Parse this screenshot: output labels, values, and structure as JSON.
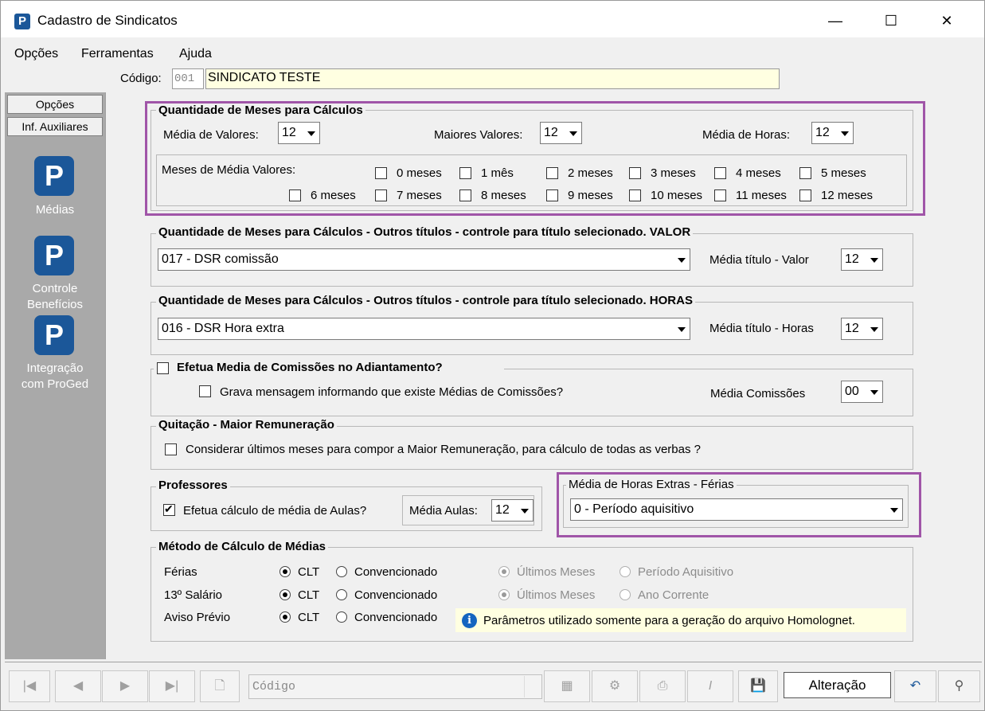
{
  "window": {
    "title": "Cadastro de Sindicatos",
    "minimize": "—",
    "maximize": "☐",
    "close": "✕"
  },
  "menu": {
    "items": [
      "Opções",
      "Ferramentas",
      "Ajuda"
    ]
  },
  "codigo": {
    "label": "Código:",
    "code": "001",
    "name": "SINDICATO TESTE"
  },
  "sidebar": {
    "tabs": [
      "Opções",
      "Inf. Auxiliares"
    ],
    "items": [
      {
        "label": "Médias",
        "icon": "p-logo-icon"
      },
      {
        "label": "Controle\nBenefícios",
        "label1": "Controle",
        "label2": "Benefícios",
        "icon": "p-logo-icon"
      },
      {
        "label1": "Integração",
        "label2": "com ProGed",
        "icon": "p-logo-icon"
      }
    ]
  },
  "qtd_meses": {
    "title": "Quantidade de Meses para Cálculos",
    "media_valores_label": "Média de Valores:",
    "media_valores": "12",
    "maiores_valores_label": "Maiores Valores:",
    "maiores_valores": "12",
    "media_horas_label": "Média de Horas:",
    "media_horas": "12",
    "meses_media_label": "Meses de Média Valores:",
    "meses": [
      "0 meses",
      "1 mês",
      "2 meses",
      "3 meses",
      "4 meses",
      "5 meses",
      "6 meses",
      "7 meses",
      "8 meses",
      "9 meses",
      "10 meses",
      "11 meses",
      "12 meses"
    ]
  },
  "outros_valor": {
    "title": "Quantidade de Meses para Cálculos - Outros títulos - controle para título selecionado. VALOR",
    "titulo": "017 - DSR comissão",
    "media_label": "Média título - Valor",
    "media": "12"
  },
  "outros_horas": {
    "title": "Quantidade de Meses para Cálculos - Outros títulos - controle para título selecionado. HORAS",
    "titulo": "016 - DSR Hora extra",
    "media_label": "Média título - Horas",
    "media": "12"
  },
  "comissoes": {
    "title": "Efetua Media de Comissões no Adiantamento?",
    "grava_label": "Grava mensagem informando que existe Médias de Comissões?",
    "media_label": "Média Comissões",
    "media": "00"
  },
  "quitacao": {
    "title": "Quitação - Maior Remuneração",
    "considerar_label": "Considerar últimos meses para compor a Maior Remuneração, para cálculo de todas as verbas ?"
  },
  "professores": {
    "title": "Professores",
    "efetua_label": "Efetua cálculo de média de Aulas?",
    "efetua_checked": true,
    "media_label": "Média Aulas:",
    "media": "12"
  },
  "horas_extras_ferias": {
    "title": "Média de Horas Extras - Férias",
    "value": "0 - Período aquisitivo"
  },
  "metodo": {
    "title": "Método de Cálculo de Médias",
    "rows": [
      {
        "label": "Férias",
        "clt": "CLT",
        "conv": "Convencionado",
        "opt1": "Últimos Meses",
        "opt2": "Período Aquisitivo"
      },
      {
        "label": "13º Salário",
        "clt": "CLT",
        "conv": "Convencionado",
        "opt1": "Últimos Meses",
        "opt2": "Ano Corrente"
      },
      {
        "label": "Aviso Prévio",
        "clt": "CLT",
        "conv": "Convencionado"
      }
    ],
    "info": "Parâmetros utilizado somente para a geração do arquivo Homolognet."
  },
  "toolbar": {
    "codigo_placeholder": "Código",
    "status": "Alteração"
  },
  "colors": {
    "highlight": "#a055a8",
    "brand": "#1b5799",
    "sidebar": "#a9a9a9",
    "code_bg": "#ffffe1"
  }
}
